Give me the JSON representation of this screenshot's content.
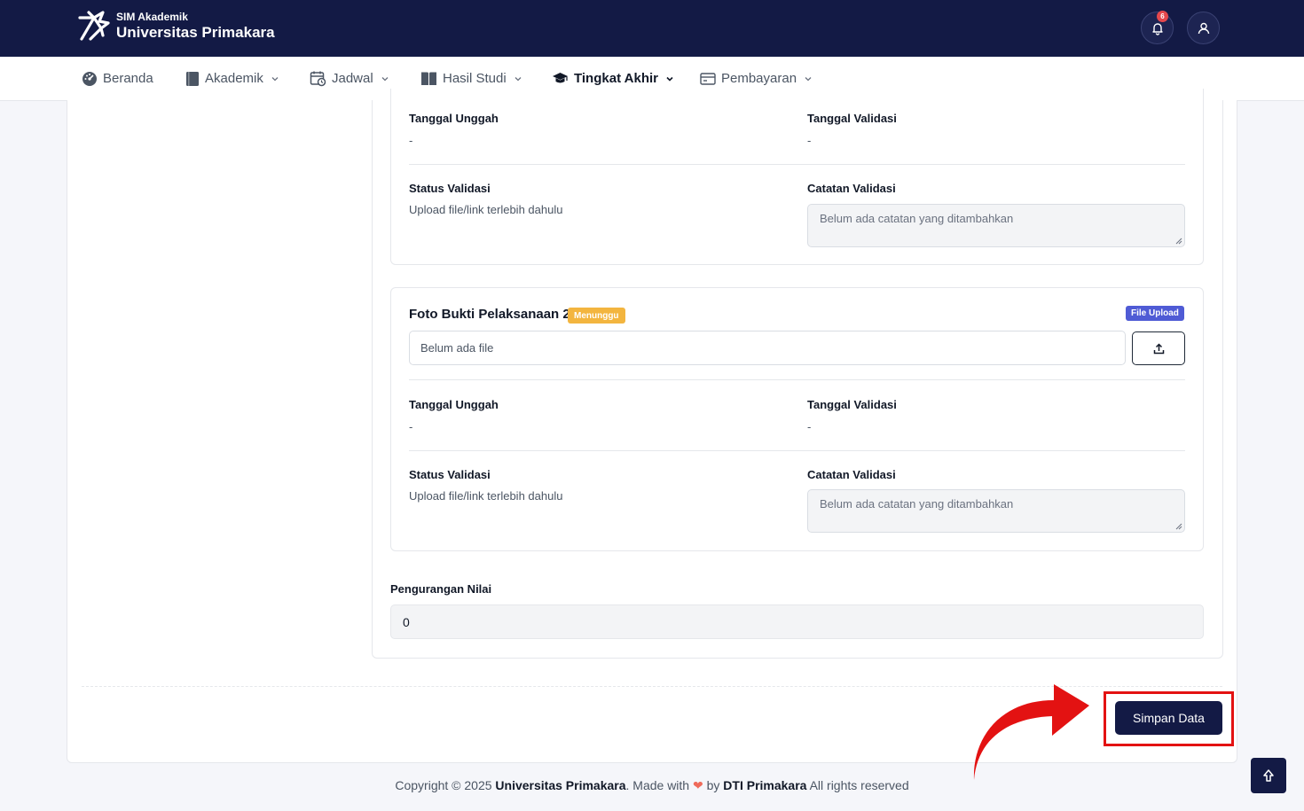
{
  "header": {
    "app_name": "SIM Akademik",
    "university": "Universitas Primakara",
    "notification_count": "6",
    "icons": [
      "logo-icon",
      "bell-icon",
      "user-icon"
    ]
  },
  "nav": {
    "items": [
      {
        "label": "Beranda",
        "icon": "dashboard-icon",
        "dropdown": false
      },
      {
        "label": "Akademik",
        "icon": "book-icon",
        "dropdown": true
      },
      {
        "label": "Jadwal",
        "icon": "calendar-clock-icon",
        "dropdown": true
      },
      {
        "label": "Hasil Studi",
        "icon": "open-book-icon",
        "dropdown": true
      },
      {
        "label": "Tingkat Akhir",
        "icon": "graduation-cap-icon",
        "dropdown": true,
        "active": true
      },
      {
        "label": "Pembayaran",
        "icon": "wallet-icon",
        "dropdown": true
      }
    ]
  },
  "doc1": {
    "upload_date_label": "Tanggal Unggah",
    "upload_date_value": "-",
    "validation_date_label": "Tanggal Validasi",
    "validation_date_value": "-",
    "status_label": "Status Validasi",
    "status_value": "Upload file/link terlebih dahulu",
    "notes_label": "Catatan Validasi",
    "notes_placeholder": "Belum ada catatan yang ditambahkan"
  },
  "doc2": {
    "title": "Foto Bukti Pelaksanaan 2",
    "status_badge": "Menunggu",
    "type_badge": "File Upload",
    "file_placeholder": "Belum ada file",
    "upload_date_label": "Tanggal Unggah",
    "upload_date_value": "-",
    "validation_date_label": "Tanggal Validasi",
    "validation_date_value": "-",
    "status_label": "Status Validasi",
    "status_value": "Upload file/link terlebih dahulu",
    "notes_label": "Catatan Validasi",
    "notes_placeholder": "Belum ada catatan yang ditambahkan"
  },
  "grade_reduction": {
    "label": "Pengurangan Nilai",
    "value": "0"
  },
  "actions": {
    "save_label": "Simpan Data"
  },
  "footer": {
    "prefix": "Copyright © 2025 ",
    "university": "Universitas Primakara",
    "made_with": ". Made with ",
    "by": " by ",
    "team": "DTI Primakara",
    "suffix": " All rights reserved"
  },
  "colors": {
    "primary": "#131a45",
    "badge_waiting": "#f3b53f",
    "badge_type": "#4f5bd5",
    "annotation_red": "#e31212"
  }
}
